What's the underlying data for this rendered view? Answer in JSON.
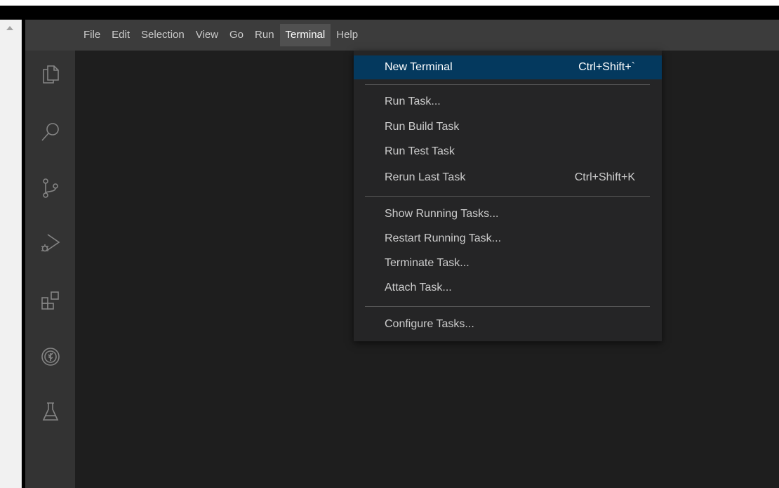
{
  "menubar": {
    "items": [
      {
        "label": "File"
      },
      {
        "label": "Edit"
      },
      {
        "label": "Selection"
      },
      {
        "label": "View"
      },
      {
        "label": "Go"
      },
      {
        "label": "Run"
      },
      {
        "label": "Terminal",
        "active": true
      },
      {
        "label": "Help"
      }
    ]
  },
  "activity_bar": {
    "icons": [
      "files-icon",
      "search-icon",
      "source-control-icon",
      "run-debug-icon",
      "extensions-icon",
      "tree-icon",
      "testing-icon"
    ]
  },
  "terminal_menu": {
    "new_terminal": {
      "label": "New Terminal",
      "shortcut": "Ctrl+Shift+`"
    },
    "run_task": {
      "label": "Run Task..."
    },
    "run_build_task": {
      "label": "Run Build Task"
    },
    "run_test_task": {
      "label": "Run Test Task"
    },
    "rerun_last_task": {
      "label": "Rerun Last Task",
      "shortcut": "Ctrl+Shift+K"
    },
    "show_running_tasks": {
      "label": "Show Running Tasks..."
    },
    "restart_running_task": {
      "label": "Restart Running Task..."
    },
    "terminate_task": {
      "label": "Terminate Task..."
    },
    "attach_task": {
      "label": "Attach Task..."
    },
    "configure_tasks": {
      "label": "Configure Tasks..."
    }
  },
  "colors": {
    "titlebar": "#3c3c3c",
    "activity_bar": "#333333",
    "editor": "#1e1e1e",
    "menu_bg": "#252526",
    "highlight": "#04395e"
  }
}
